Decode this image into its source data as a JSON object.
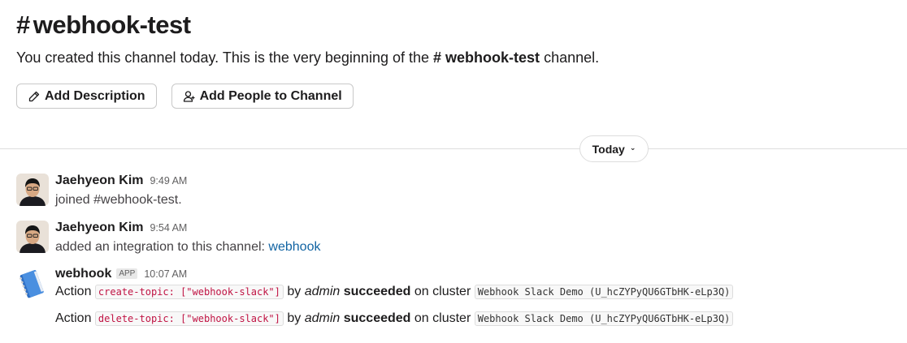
{
  "channel": {
    "hash": "#",
    "name": "webhook-test",
    "intro_prefix": "You created this channel today. This is the very beginning of the",
    "intro_channel": "# webhook-test",
    "intro_suffix": "channel."
  },
  "actions": {
    "add_description": "Add Description",
    "add_people": "Add People to Channel"
  },
  "divider": {
    "label": "Today"
  },
  "messages": [
    {
      "sender": "Jaehyeon Kim",
      "time": "9:49 AM",
      "text": "joined #webhook-test."
    },
    {
      "sender": "Jaehyeon Kim",
      "time": "9:54 AM",
      "text": "added an integration to this channel:",
      "link": "webhook"
    },
    {
      "sender": "webhook",
      "badge": "APP",
      "time": "10:07 AM",
      "lines": [
        {
          "prefix": "Action",
          "code": "create-topic: [\"webhook-slack\"]",
          "by": "by",
          "user": "admin",
          "status": "succeeded",
          "on": "on cluster",
          "cluster": "Webhook Slack Demo (U_hcZYPyQU6GTbHK-eLp3Q)"
        },
        {
          "prefix": "Action",
          "code": "delete-topic: [\"webhook-slack\"]",
          "by": "by",
          "user": "admin",
          "status": "succeeded",
          "on": "on cluster",
          "cluster": "Webhook Slack Demo (U_hcZYPyQU6GTbHK-eLp3Q)"
        }
      ]
    }
  ],
  "icons": [
    "pencil-icon",
    "add-person-icon",
    "chevron-down-icon",
    "notebook-icon"
  ]
}
